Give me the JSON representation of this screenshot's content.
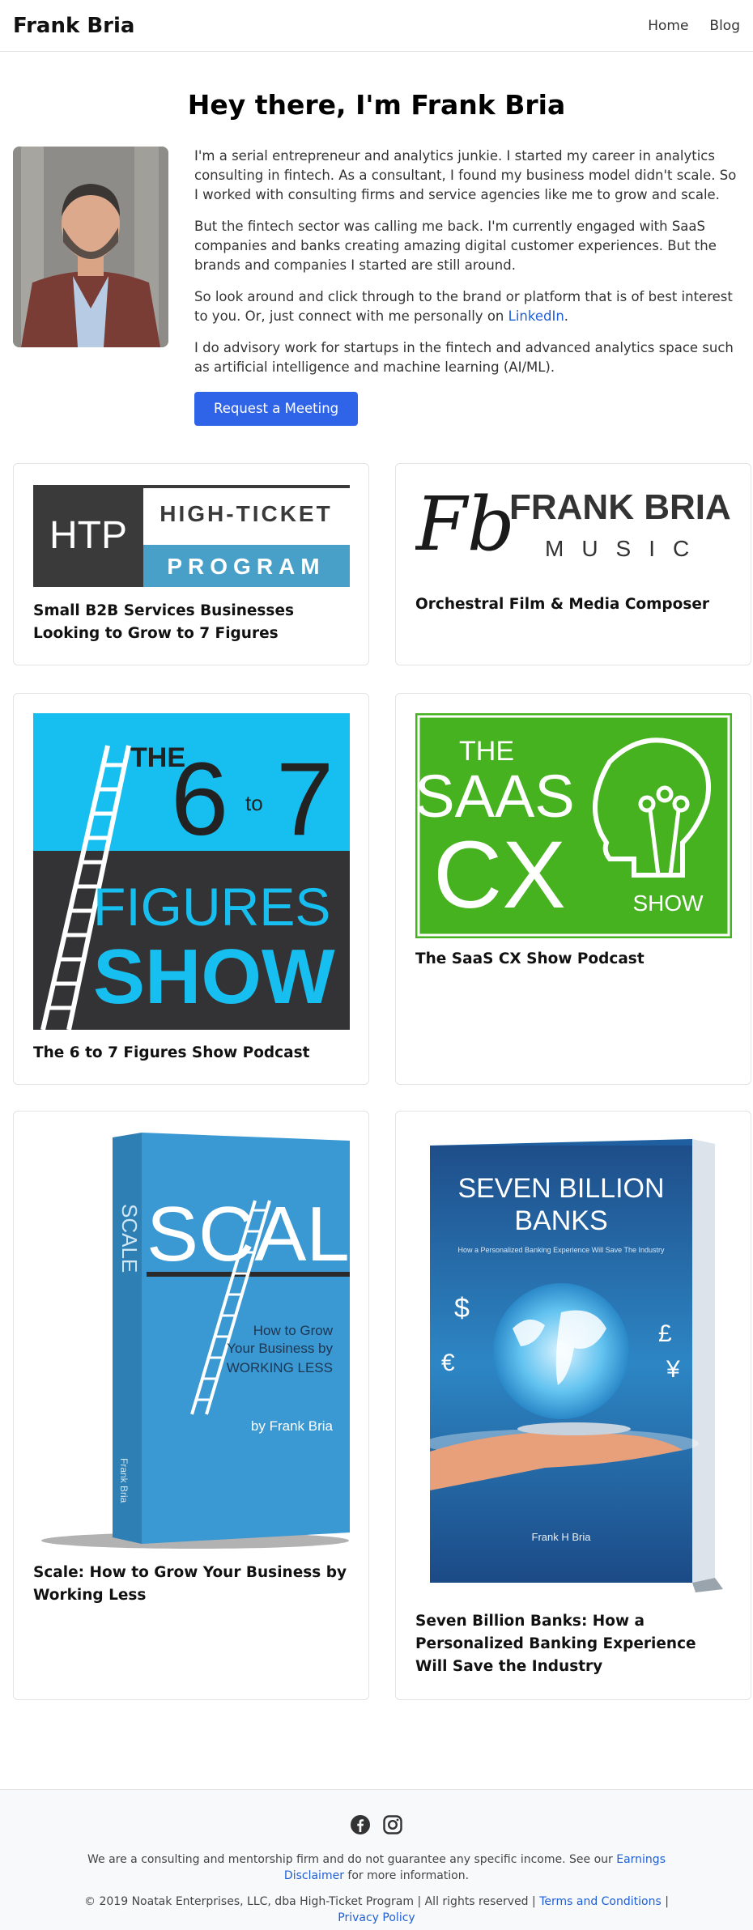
{
  "nav": {
    "brand": "Frank Bria",
    "links": [
      "Home",
      "Blog"
    ]
  },
  "hero": {
    "title": "Hey there, I'm Frank Bria"
  },
  "intro": {
    "p1": "I'm a serial entrepreneur and analytics junkie. I started my career in analytics consulting in fintech. As a consultant, I found my business model didn't scale. So I worked with consulting firms and service agencies like me to grow and scale.",
    "p2": "But the fintech sector was calling me back. I'm currently engaged with SaaS companies and banks creating amazing digital customer experiences. But the brands and companies I started are still around.",
    "p3_before": "So look around and click through to the brand or platform that is of best interest to you. Or, just connect with me personally on ",
    "p3_link": "LinkedIn",
    "p3_after": ".",
    "p4": "I do advisory work for startups in the fintech and advanced analytics space such as artificial intelligence and machine learning (AI/ML).",
    "button": "Request a Meeting"
  },
  "cards": [
    {
      "title": "Small B2B Services Businesses Looking to Grow to 7 Figures",
      "logo": {
        "mark": "HTP",
        "line1": "HIGH-TICKET",
        "line2": "PROGRAM"
      }
    },
    {
      "title": "Orchestral Film & Media Composer",
      "logo": {
        "mark": "Fb",
        "line1": "FRANK BRIA",
        "line2": "MUSIC"
      }
    },
    {
      "title": "The 6 to 7 Figures Show Podcast",
      "art": {
        "the": "THE",
        "six": "6",
        "to": "to",
        "seven": "7",
        "figures": "FIGURES",
        "show": "SHOW"
      }
    },
    {
      "title": "The SaaS CX Show Podcast",
      "art": {
        "the": "THE",
        "saas": "SAAS",
        "cx": "CX",
        "show": "SHOW"
      }
    },
    {
      "title": "Scale: How to Grow Your Business by Working Less",
      "book": {
        "title": "SCALE",
        "spine": "SCALE",
        "subtitle": "How to Grow Your Business by WORKING LESS",
        "author": "by Frank Bria",
        "spine_author": "Frank Bria"
      }
    },
    {
      "title": "Seven Billion Banks: How a Personalized Banking Experience Will Save the Industry",
      "book": {
        "title1": "SEVEN BILLION",
        "title2": "BANKS",
        "subtitle": "How a Personalized Banking Experience Will Save The Industry",
        "author": "Frank H Bria"
      }
    }
  ],
  "footer": {
    "disclaimer_before": "We are a consulting and mentorship firm and do not guarantee any specific income. See our ",
    "disclaimer_link": "Earnings Disclaimer",
    "disclaimer_after": " for more information.",
    "copyright": "© 2019 Noatak Enterprises, LLC, dba High-Ticket Program | All rights reserved | ",
    "terms": "Terms and Conditions",
    "sep": " |",
    "privacy": "Privacy Policy"
  },
  "icons": [
    "facebook-icon",
    "instagram-icon"
  ]
}
